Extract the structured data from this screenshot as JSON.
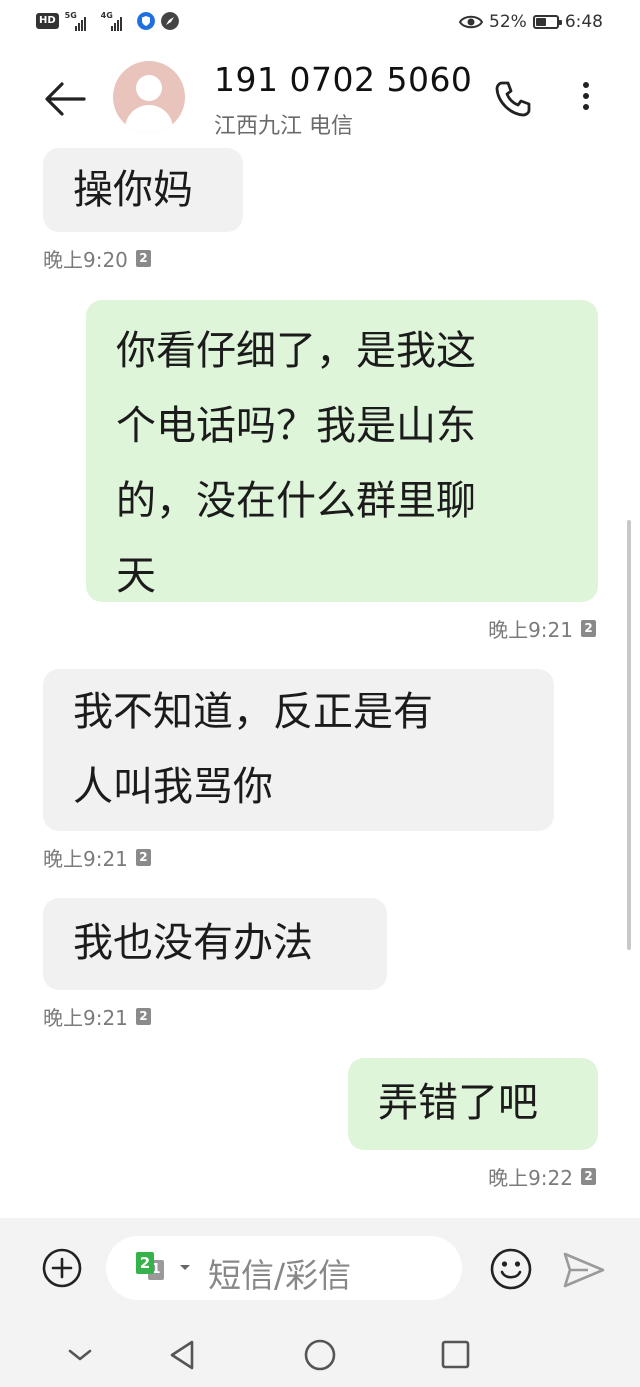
{
  "status_bar": {
    "hd": "HD",
    "net1": "5G",
    "net2": "4G",
    "battery_pct": "52%",
    "battery_level": 0.52,
    "time": "6:48"
  },
  "header": {
    "contact_number": "191 0702 5060",
    "contact_subtitle": "江西九江 电信"
  },
  "messages": [
    {
      "direction": "in",
      "text": "操你妈",
      "time": "晚上9:20",
      "sim": "2"
    },
    {
      "direction": "out",
      "lines": [
        "你看仔细了，是我这",
        "个电话吗？我是山东",
        "的，没在什么群里聊",
        "天"
      ],
      "time": "晚上9:21",
      "sim": "2"
    },
    {
      "direction": "in",
      "lines": [
        "我不知道，反正是有",
        "人叫我骂你"
      ],
      "time": "晚上9:21",
      "sim": "2"
    },
    {
      "direction": "in",
      "text": "我也没有办法",
      "time": "晚上9:21",
      "sim": "2"
    },
    {
      "direction": "out",
      "text": "弄错了吧",
      "time": "晚上9:22",
      "sim": "2"
    }
  ],
  "compose": {
    "sim_primary": "2",
    "sim_secondary": "1",
    "placeholder": "短信/彩信"
  },
  "colors": {
    "incoming_bubble": "#f1f1f1",
    "outgoing_bubble": "#dff5da",
    "sim_green": "#36b24a"
  },
  "icons": [
    "back-arrow-icon",
    "phone-icon",
    "more-vert-icon",
    "add-circle-icon",
    "emoji-icon",
    "send-icon",
    "nav-down-icon",
    "nav-back-icon",
    "nav-home-icon",
    "nav-recents-icon"
  ]
}
